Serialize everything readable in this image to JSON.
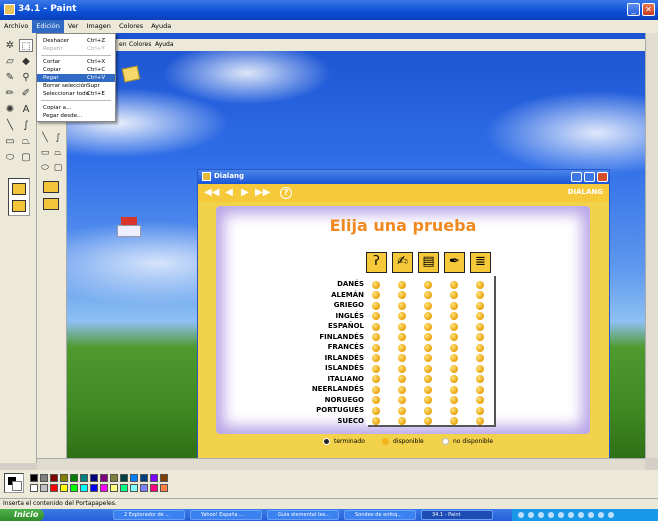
{
  "window": {
    "title": "34.1 - Paint"
  },
  "menubar": [
    "Archivo",
    "Edición",
    "Ver",
    "Imagen",
    "Colores",
    "Ayuda"
  ],
  "edit_menu": {
    "items": [
      {
        "label": "Deshacer",
        "shortcut": "Ctrl+Z",
        "state": "normal"
      },
      {
        "label": "Repetir",
        "shortcut": "Ctrl+Y",
        "state": "disabled"
      },
      {
        "label": "Cortar",
        "shortcut": "Ctrl+X",
        "state": "normal"
      },
      {
        "label": "Copiar",
        "shortcut": "Ctrl+C",
        "state": "normal"
      },
      {
        "label": "Pegar",
        "shortcut": "Ctrl+V",
        "state": "highlighted"
      },
      {
        "label": "Borrar selección",
        "shortcut": "Supr",
        "state": "normal"
      },
      {
        "label": "Seleccionar todo",
        "shortcut": "Ctrl+E",
        "state": "normal"
      },
      {
        "label": "Copiar a...",
        "shortcut": "",
        "state": "normal"
      },
      {
        "label": "Pegar desde...",
        "shortcut": "",
        "state": "normal"
      }
    ]
  },
  "inner_menu": [
    "en",
    "Colores",
    "Ayuda"
  ],
  "dialang": {
    "title": "Dialang",
    "brand": "DIALANG",
    "heading": "Elija una prueba",
    "skills": [
      "ear-icon",
      "writing-icon",
      "book-icon",
      "pen-icon",
      "grammar-icon"
    ],
    "languages": [
      "DANÉS",
      "ALEMÁN",
      "GRIEGO",
      "INGLÉS",
      "ESPAÑOL",
      "FINLANDÉS",
      "FRANCÉS",
      "IRLANDÉS",
      "ISLANDÉS",
      "ITALIANO",
      "NEERLANDÉS",
      "NORUEGO",
      "PORTUGUÉS",
      "SUECO"
    ],
    "legend": {
      "finished": "terminado",
      "available": "disponible",
      "unavailable": "no disponible"
    }
  },
  "status_text": "Inserta el contenido del Portapapeles.",
  "taskbar": {
    "start": "Inicio",
    "tasks": [
      "2 Explorador de ...",
      "Yahoo! España ...",
      "Guía elemental tes...",
      "Sondeo de enfoq...",
      "34.1 - Paint"
    ]
  },
  "palette": [
    "#000000",
    "#808080",
    "#800000",
    "#808000",
    "#008000",
    "#008080",
    "#000080",
    "#800080",
    "#808040",
    "#004040",
    "#0080ff",
    "#004080",
    "#8000ff",
    "#804000",
    "#ffffff",
    "#c0c0c0",
    "#ff0000",
    "#ffff00",
    "#00ff00",
    "#00ffff",
    "#0000ff",
    "#ff00ff",
    "#ffff80",
    "#00ff80",
    "#80ffff",
    "#8080ff",
    "#ff0080",
    "#ff8040"
  ]
}
